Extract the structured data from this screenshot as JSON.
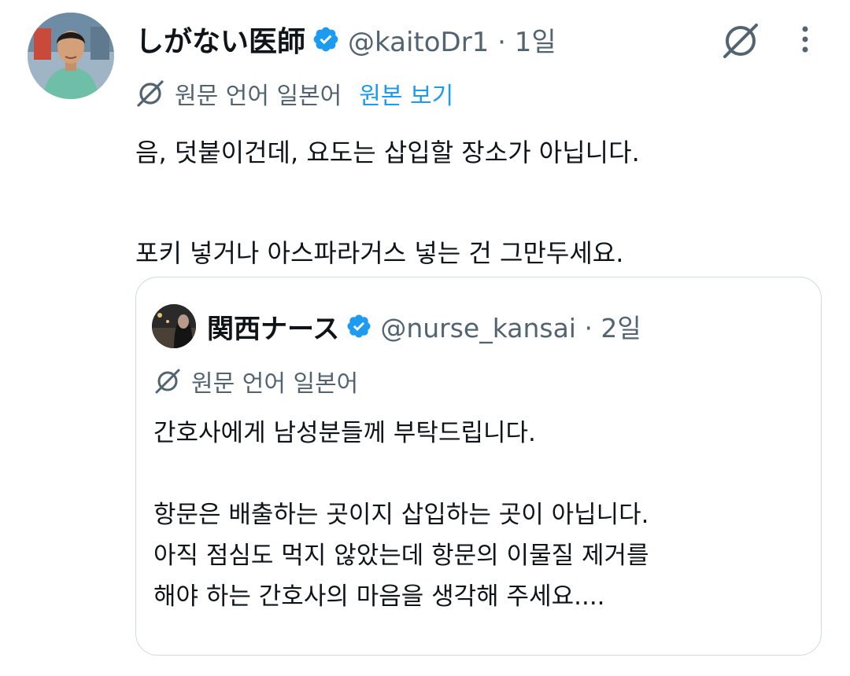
{
  "tweet": {
    "author_name": "しがない医師",
    "handle_time": "@kaitoDr1 · 1일",
    "translation_label": "원문 언어 일본어",
    "show_original": "원본 보기",
    "text": "음, 덧붙이건데, 요도는 삽입할 장소가 아닙니다.\n\n포키 넣거나 아스파라거스 넣는 건 그만두세요.",
    "icons": {
      "verified": "verified-badge-icon",
      "grok": "grok-icon",
      "more": "more-options-icon",
      "translate": "translate-globe-icon"
    }
  },
  "quote": {
    "author_name": "関西ナース",
    "handle_time": "@nurse_kansai · 2일",
    "translation_label": "원문 언어 일본어",
    "text": "간호사에게 남성분들께 부탁드립니다.\n\n항문은 배출하는 곳이지 삽입하는 곳이 아닙니다.\n아직 점심도 먹지 않았는데 항문의 이물질 제거를\n해야 하는 간호사의 마음을 생각해 주세요...."
  },
  "colors": {
    "accent": "#1d9bf0",
    "secondary_text": "#536471",
    "border": "#cfd9de"
  }
}
